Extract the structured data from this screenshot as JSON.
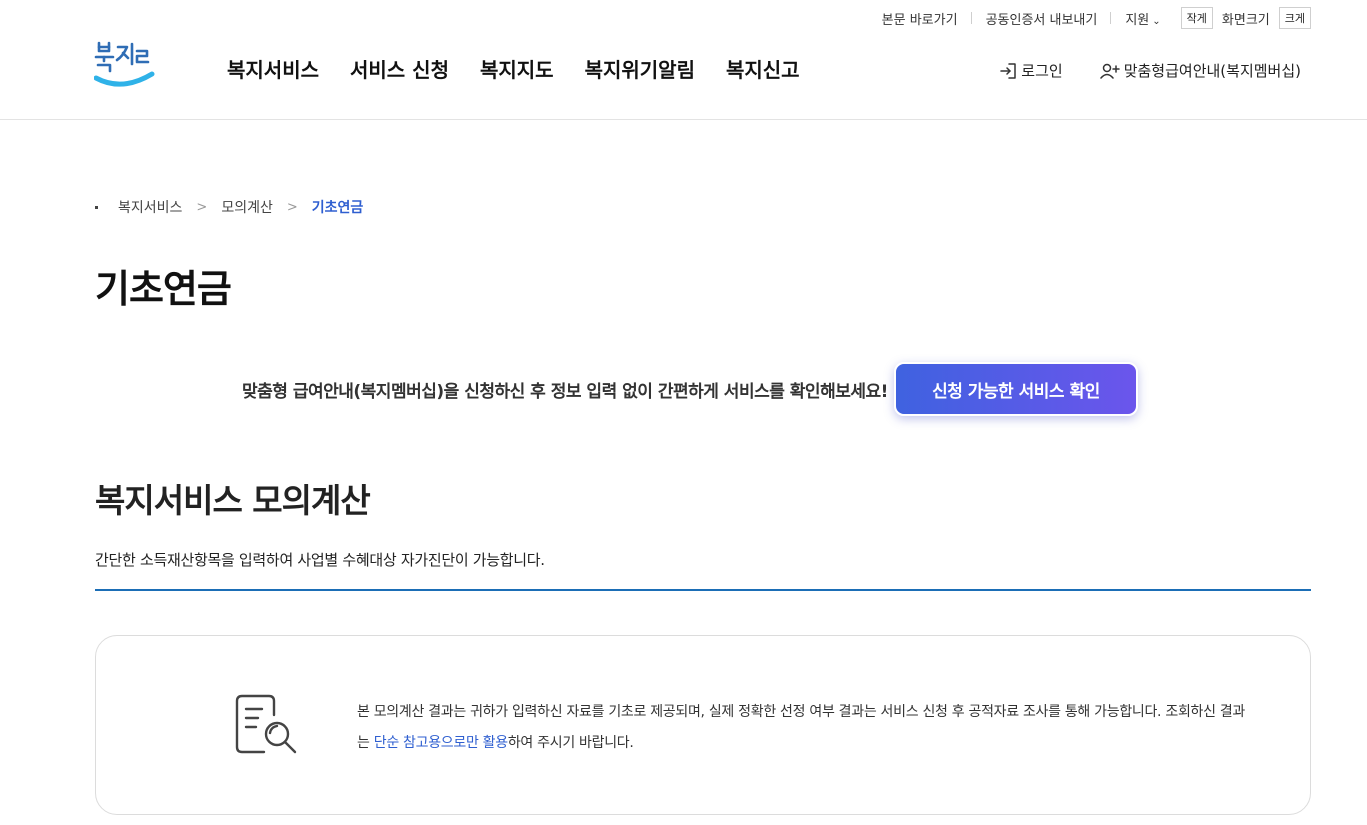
{
  "utility": {
    "skip_to_content": "본문 바로가기",
    "export_cert": "공동인증서 내보내기",
    "support": "지원",
    "font_small": "작게",
    "font_label": "화면크기",
    "font_large": "크게"
  },
  "logo": {
    "text": "복지로"
  },
  "gnb": [
    "복지서비스",
    "서비스 신청",
    "복지지도",
    "복지위기알림",
    "복지신고"
  ],
  "account": {
    "login": "로그인",
    "membership": "맞춤형급여안내(복지멤버십)"
  },
  "breadcrumb": [
    "복지서비스",
    "모의계산",
    "기초연금"
  ],
  "page_title": "기초연금",
  "promo": {
    "text": "맞춤형 급여안내(복지멤버십)을 신청하신 후 정보 입력 없이 간편하게 서비스를 확인해보세요!",
    "button": "신청 가능한 서비스 확인"
  },
  "section": {
    "title": "복지서비스 모의계산",
    "description": "간단한 소득재산항목을 입력하여 사업별 수혜대상 자가진단이 가능합니다."
  },
  "notice": {
    "text_before": "본 모의계산 결과는 귀하가 입력하신 자료를 기초로 제공되며, 실제 정확한 선정 여부 결과는 서비스 신청 후 공적자료 조사를 통해 가능합니다. 조회하신 결과는 ",
    "highlight": "단순 참고용으로만 활용",
    "text_after": "하여 주시기 바랍니다."
  },
  "colors": {
    "accent": "#2f5fd0",
    "divider": "#1b6eb6",
    "button_start": "#3f62e0",
    "button_end": "#6b55ec"
  },
  "icons": [
    "chevron-down-icon",
    "login-icon",
    "user-add-icon",
    "chevron-right-icon",
    "document-search-icon"
  ]
}
